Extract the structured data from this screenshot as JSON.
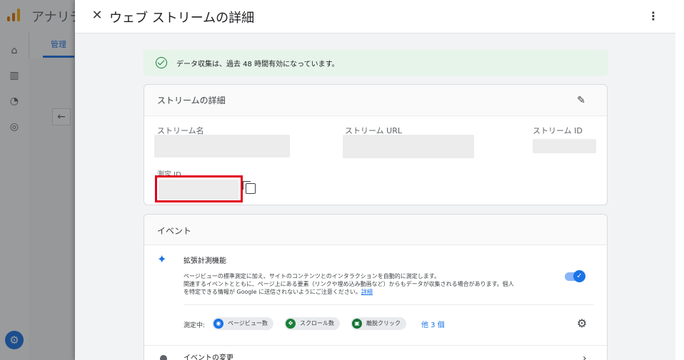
{
  "background": {
    "app_title": "アナリテ",
    "tab_label": "管理"
  },
  "panel": {
    "title": "ウェブ ストリームの詳細",
    "notice": "データ収集は、過去 48 時間有効になっています。",
    "stream_details": {
      "heading": "ストリームの詳細",
      "stream_name_label": "ストリーム名",
      "stream_url_label": "ストリーム URL",
      "stream_id_label": "ストリーム ID",
      "measurement_id_label": "測定 ID"
    },
    "events": {
      "heading": "イベント",
      "enhanced_title": "拡張計測機能",
      "enhanced_desc_1": "ページビューの標準測定に加え、サイトのコンテンツとのインタラクションを自動的に測定します。",
      "enhanced_desc_2": "関連するイベントとともに、ページ上にある要素（リンクや埋め込み動画など）からもデータが収集される場合があります。個人",
      "enhanced_desc_3": "を特定できる情報が Google に送信されないようにご注意ください。",
      "details_link": "詳細",
      "measuring_label": "測定中:",
      "chips": [
        {
          "label": "ページビュー数",
          "icon": "eye-icon",
          "color": "#1a73e8"
        },
        {
          "label": "スクロール数",
          "icon": "move-icon",
          "color": "#188038"
        },
        {
          "label": "離脱クリック",
          "icon": "lock-icon",
          "color": "#137333"
        }
      ],
      "more_link": "他 3 個",
      "modify_events": "イベントの変更",
      "toggle_on": true
    }
  },
  "colors": {
    "accent": "#1a73e8",
    "highlight_box": "#e3001b",
    "notice_bg": "#e6f4ea"
  }
}
